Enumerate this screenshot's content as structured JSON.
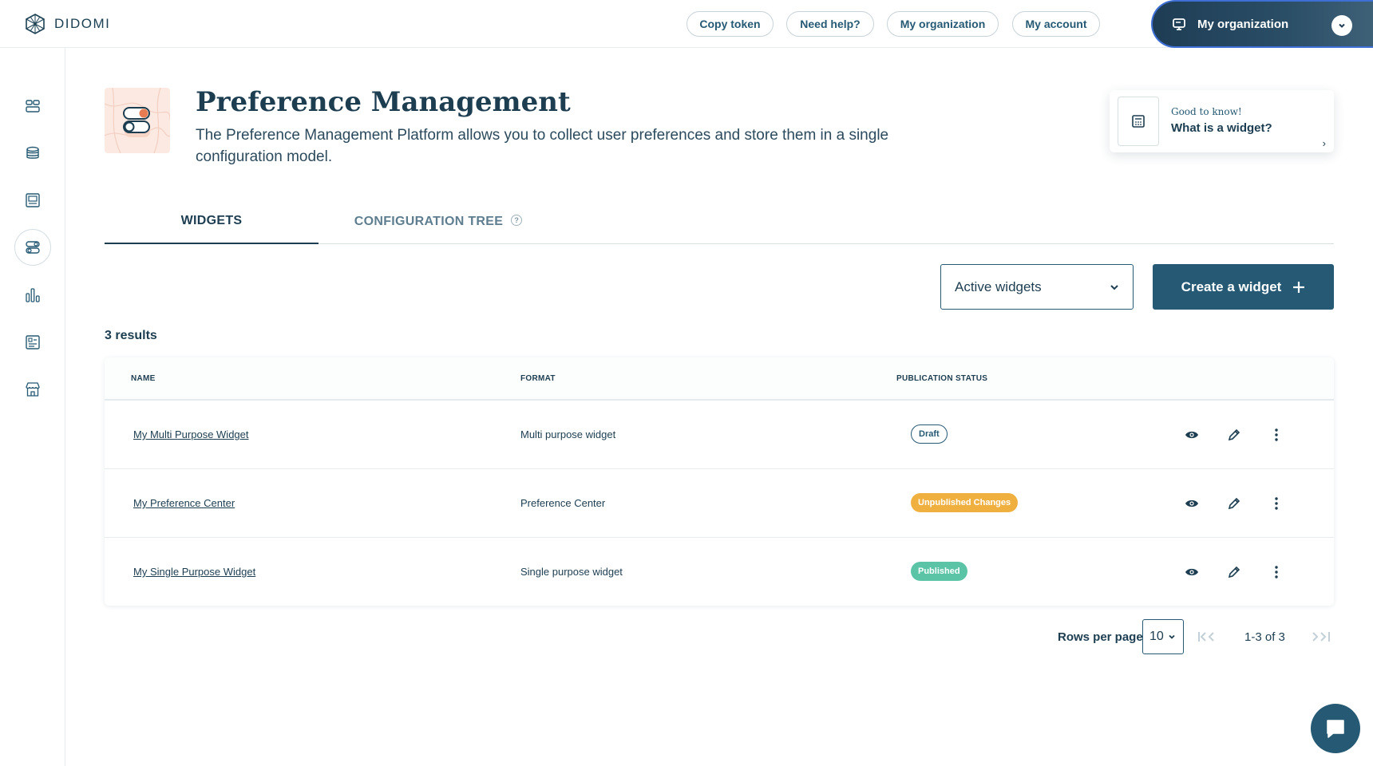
{
  "brand": {
    "name": "DIDOMI"
  },
  "header": {
    "buttons": [
      "Copy token",
      "Need help?",
      "My organization",
      "My account"
    ],
    "org_selector": {
      "label": "My organization"
    }
  },
  "sidebar": {
    "items": [
      {
        "icon": "dashboard-icon"
      },
      {
        "icon": "database-icon"
      },
      {
        "icon": "consent-notice-icon"
      },
      {
        "icon": "preference-toggle-icon",
        "active": true
      },
      {
        "icon": "analytics-chart-icon"
      },
      {
        "icon": "form-list-icon"
      },
      {
        "icon": "marketplace-store-icon"
      }
    ]
  },
  "page": {
    "title": "Preference Management",
    "description": "The Preference Management Platform allows you to collect user preferences and store them in a single configuration model."
  },
  "tip": {
    "small": "Good to know!",
    "big": "What is a widget?"
  },
  "tabs": {
    "widgets": "WIDGETS",
    "config_tree": "CONFIGURATION TREE"
  },
  "filter": {
    "selected": "Active widgets"
  },
  "create_button": {
    "label": "Create a widget"
  },
  "results": {
    "label": "3 results"
  },
  "table": {
    "headers": {
      "name": "NAME",
      "format": "FORMAT",
      "status": "PUBLICATION STATUS"
    },
    "rows": [
      {
        "name": "My Multi Purpose Widget",
        "format": "Multi purpose widget",
        "status": "Draft",
        "status_color": "#265973"
      },
      {
        "name": "My Preference Center",
        "format": "Preference Center",
        "status": "Unpublished Changes",
        "status_color": "#f0b040"
      },
      {
        "name": "My Single Purpose Widget",
        "format": "Single purpose widget",
        "status": "Published",
        "status_color": "#5cc4a6"
      }
    ]
  },
  "pagination": {
    "rows_per_page_label": "Rows per page",
    "rows_per_page": "10",
    "range": "1-3 of 3"
  },
  "colors": {
    "primary": "#265973",
    "dark": "#1d3d50",
    "accent": "#3d6fd4"
  }
}
